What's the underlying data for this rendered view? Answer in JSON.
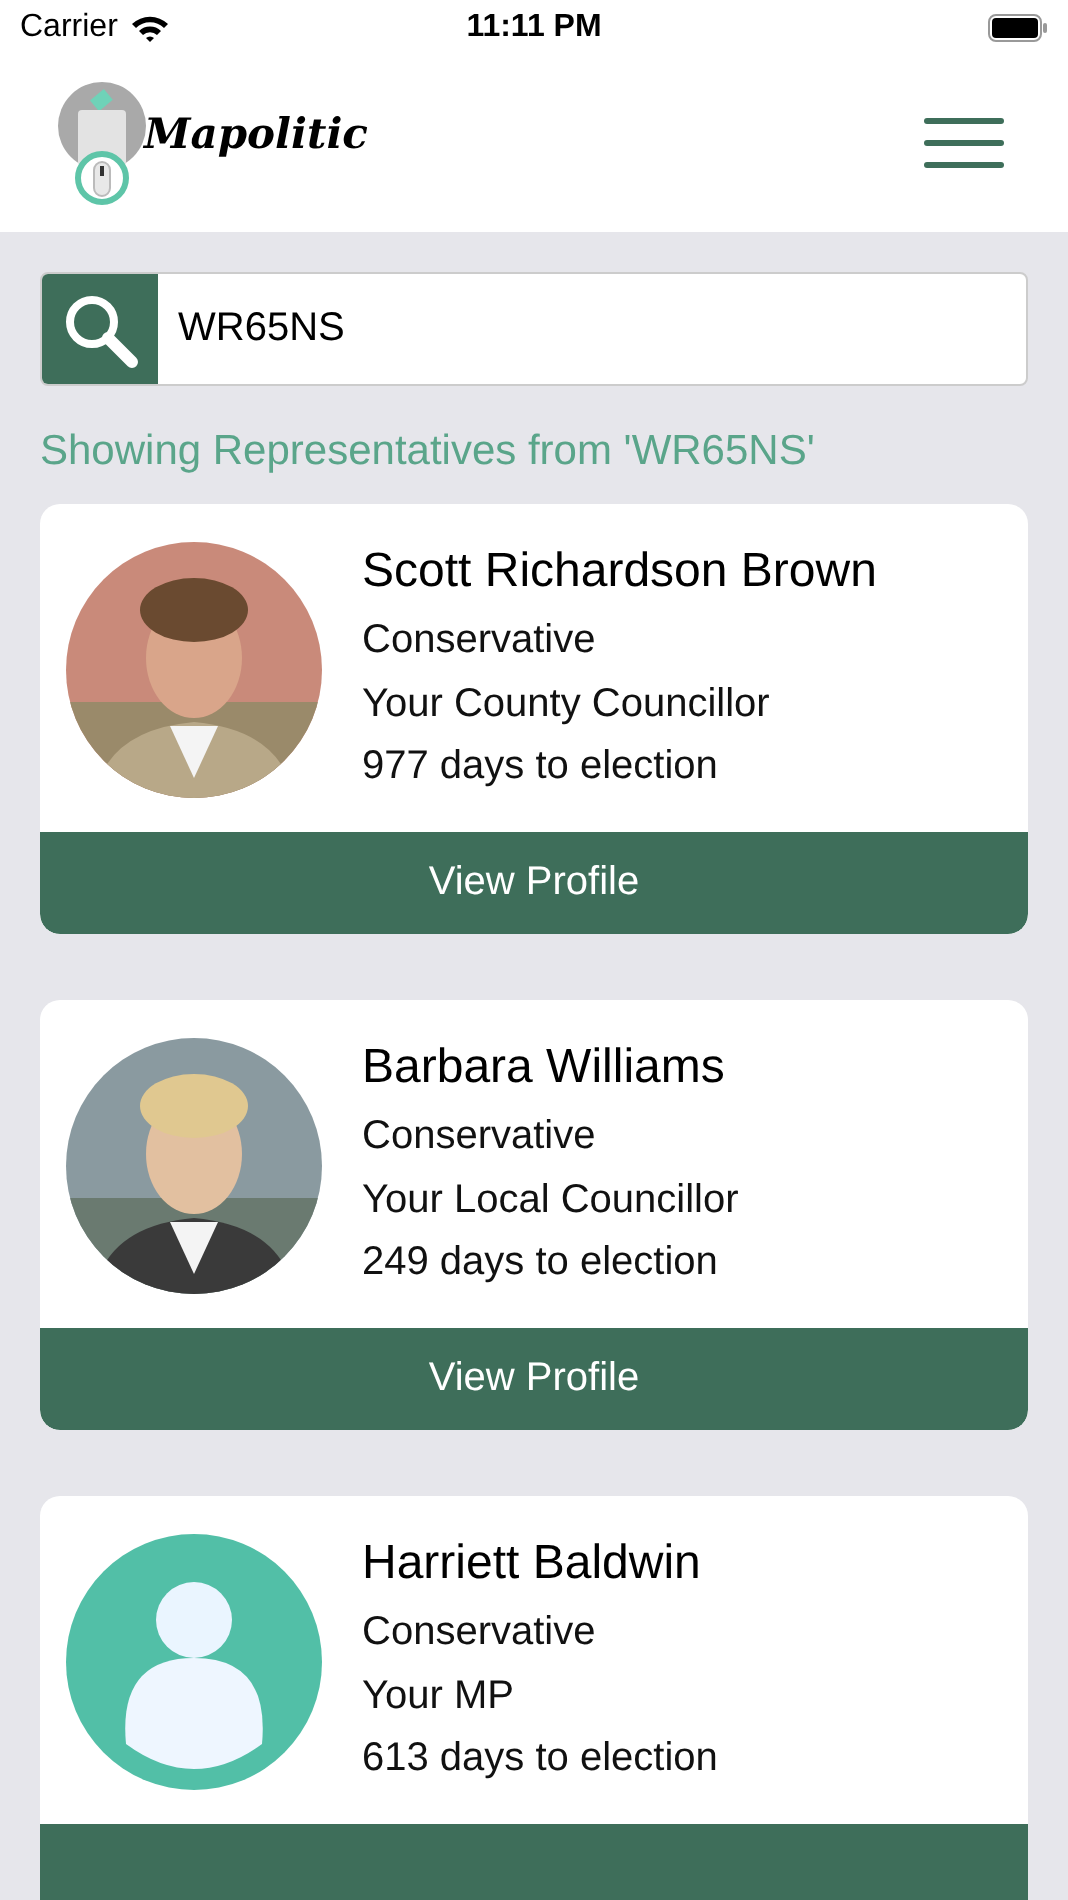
{
  "status_bar": {
    "carrier": "Carrier",
    "time": "11:11 PM"
  },
  "header": {
    "logo_text": "Mapolitic"
  },
  "search": {
    "value": "WR65NS"
  },
  "results_label": "Showing Representatives from 'WR65NS'",
  "representatives": [
    {
      "name": "Scott Richardson Brown",
      "party": "Conservative",
      "role": "Your County Councillor",
      "days": "977 days to election",
      "button": "View Profile"
    },
    {
      "name": "Barbara Williams",
      "party": "Conservative",
      "role": "Your Local Councillor",
      "days": "249 days to election",
      "button": "View Profile"
    },
    {
      "name": "Harriett Baldwin",
      "party": "Conservative",
      "role": "Your MP",
      "days": "613 days to election",
      "avatar": {
        "kind": "placeholder"
      }
    }
  ]
}
